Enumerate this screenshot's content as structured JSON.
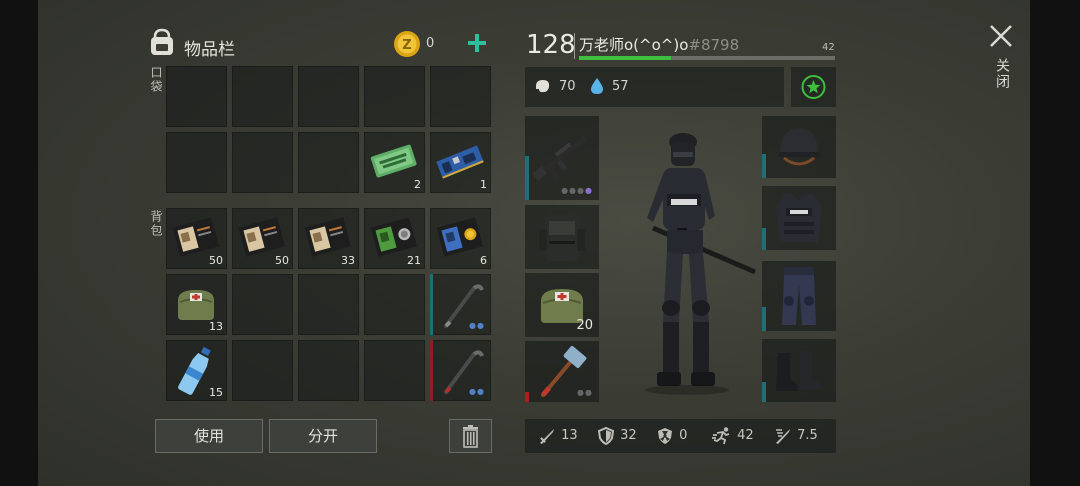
{
  "inventory": {
    "title": "物品栏",
    "coins": "0",
    "pocket_label": "口袋",
    "backpack_label": "背包",
    "pocket_items": [
      {
        "name": "ration-coupon",
        "count": "2"
      },
      {
        "name": "circuit-board",
        "count": "1"
      }
    ],
    "backpack_items": [
      {
        "name": "id-document",
        "count": "50"
      },
      {
        "name": "id-document",
        "count": "50"
      },
      {
        "name": "id-document",
        "count": "33"
      },
      {
        "name": "green-id-document",
        "count": "21"
      },
      {
        "name": "blue-id-document",
        "count": "6"
      },
      {
        "name": "medkit-bag",
        "count": "13"
      },
      {
        "name": "water-bottle",
        "count": "15"
      }
    ],
    "use_button": "使用",
    "split_button": "分开"
  },
  "player": {
    "level": "128",
    "name": "万老师o(^o^)o",
    "id": "#8798",
    "xp_value": "42",
    "xp_fraction": 0.36,
    "food": "70",
    "water": "57"
  },
  "equipment": {
    "medkit_count": "20"
  },
  "stats": {
    "attack": "13",
    "defense": "32",
    "radiation": "0",
    "speed": "42",
    "other": "7.5"
  },
  "close_label": "关闭",
  "colors": {
    "accent": "#2fbf9a",
    "xp": "#3fbf3f",
    "bar": "#1d6f78"
  }
}
